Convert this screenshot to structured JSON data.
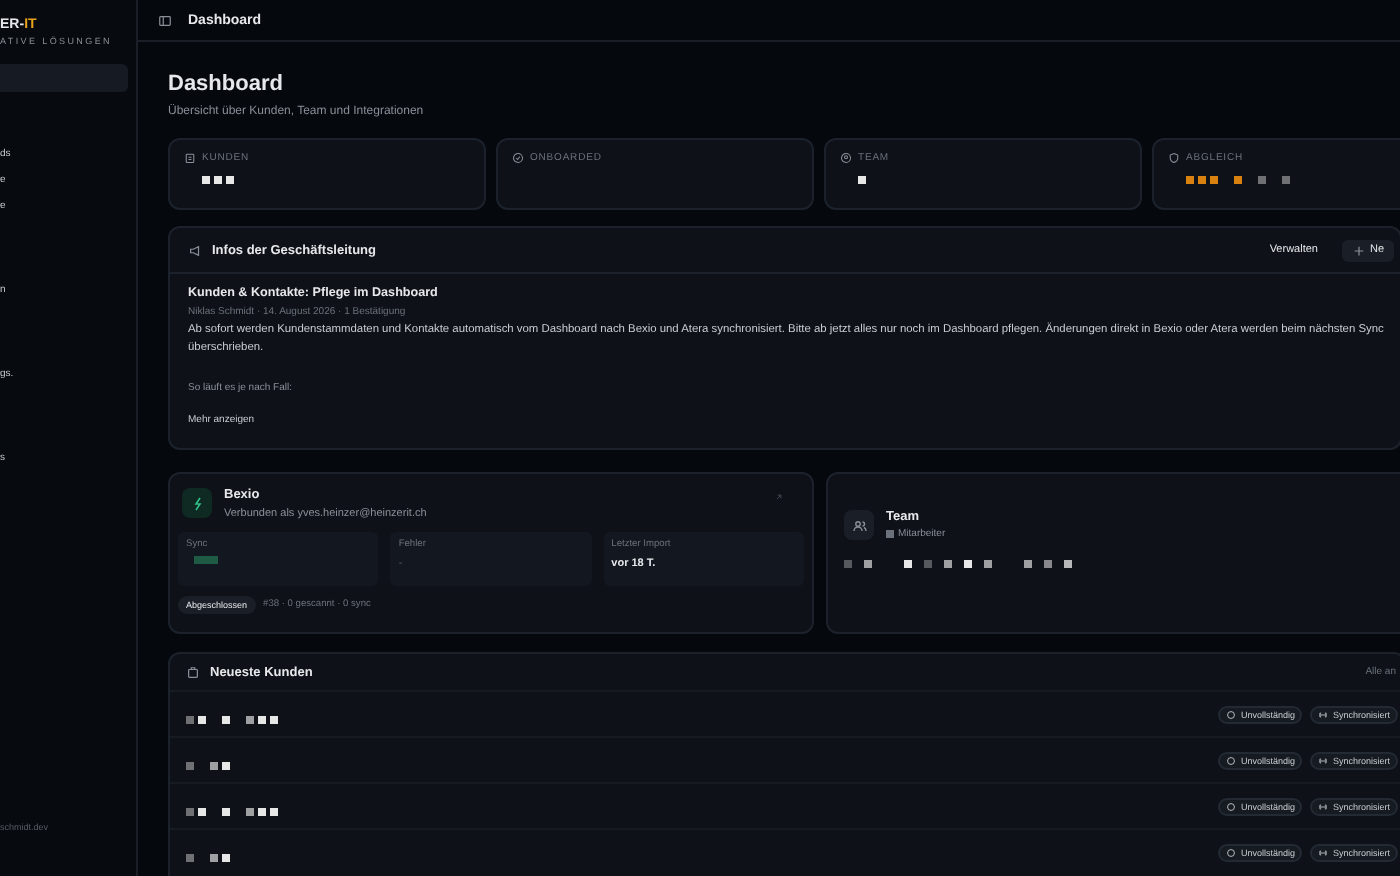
{
  "sidebar": {
    "logo_main": "ER-",
    "logo_accent": "IT",
    "tagline": "ATIVE LÖSUNGEN",
    "nav_groups": [
      {
        "items": [
          "ds",
          "e",
          "e"
        ]
      },
      {
        "items": [
          "n"
        ]
      },
      {
        "items": [
          "gs."
        ]
      },
      {
        "items": [
          "s"
        ]
      }
    ],
    "footer": "schmidt.dev"
  },
  "header": {
    "breadcrumb": "Dashboard"
  },
  "page": {
    "title": "Dashboard",
    "subtitle": "Übersicht über Kunden, Team und Integrationen"
  },
  "stats": [
    {
      "label": "KUNDEN",
      "kind": "customers",
      "accent": false
    },
    {
      "label": "ONBOARDED",
      "kind": "onboarded",
      "accent": false
    },
    {
      "label": "TEAM",
      "kind": "team",
      "accent": false
    },
    {
      "label": "ABGLEICH",
      "kind": "sync",
      "accent": true
    }
  ],
  "news": {
    "title": "Infos der Geschäftsleitung",
    "manage": "Verwalten",
    "new_button": "Ne",
    "post_title": "Kunden & Kontakte: Pflege im Dashboard",
    "meta": "Niklas Schmidt · 14. August 2026 · 1 Bestätigung",
    "body": "Ab sofort werden Kundenstammdaten und Kontakte automatisch vom Dashboard nach Bexio und Atera synchronisiert. Bitte ab jetzt alles nur noch im Dashboard pflegen. Änderungen direkt in Bexio oder Atera werden beim nächsten Sync überschrieben.",
    "note": "So läuft es je nach Fall:",
    "more": "Mehr anzeigen"
  },
  "bexio": {
    "title": "Bexio",
    "subtitle": "Verbunden als yves.heinzer@heinzerit.ch",
    "metrics": [
      {
        "label": "Sync",
        "kind": "redacted"
      },
      {
        "label": "Fehler",
        "value": "-",
        "kind": "text"
      },
      {
        "label": "Letzter Import",
        "value": "vor 18 T.",
        "kind": "text"
      }
    ],
    "status": "Abgeschlossen",
    "summary": "#38 · 0 gescannt · 0 sync"
  },
  "team": {
    "title": "Team",
    "subtitle": "Mitarbeiter"
  },
  "customers": {
    "title": "Neueste Kunden",
    "link": "Alle an",
    "rows": [
      {
        "complete": "Unvollständig",
        "sync": "Synchronisiert"
      },
      {
        "complete": "Unvollständig",
        "sync": "Synchronisiert"
      },
      {
        "complete": "Unvollständig",
        "sync": "Synchronisiert"
      },
      {
        "complete": "Unvollständig",
        "sync": "Synchronisiert"
      }
    ]
  }
}
